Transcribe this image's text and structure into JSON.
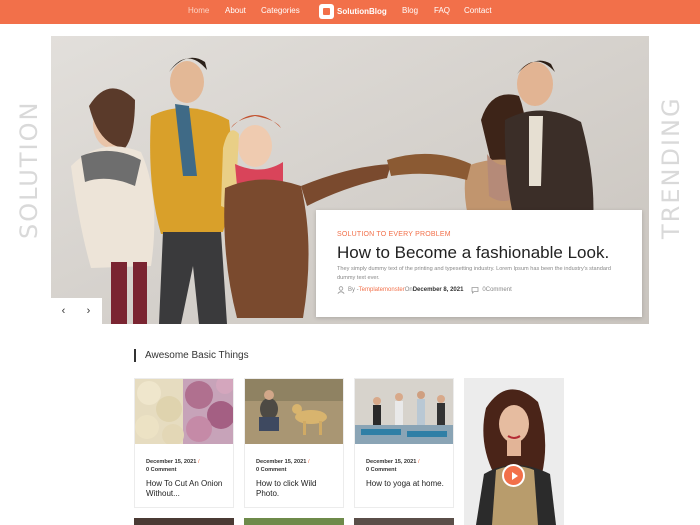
{
  "nav": {
    "items": [
      {
        "label": "Home",
        "active": true
      },
      {
        "label": "About"
      },
      {
        "label": "Categories"
      },
      {
        "label": "Blog"
      },
      {
        "label": "FAQ"
      },
      {
        "label": "Contact"
      }
    ],
    "logo_text": "SolutionBlog"
  },
  "hero": {
    "side_left": "SOLUTION",
    "side_right": "TRENDING",
    "kicker": "SOLUTION TO EVERY PROBLEM",
    "title": "How to Become a fashionable Look.",
    "description": "They simply dummy text of the printing and typesetting industry. Lorem Ipsum has been the industry's standard dummy text ever.",
    "meta": {
      "by": "By - ",
      "author": "Templatemonster",
      "on": " On ",
      "date": "December 8, 2021",
      "comments": "0Comment"
    },
    "prev_arrow": "‹",
    "next_arrow": "›"
  },
  "section": {
    "title": "Awesome Basic Things"
  },
  "posts": [
    {
      "date": "December 15, 2021",
      "sep": "/",
      "comment": "0 Comment",
      "title": "How To Cut An Onion Without..."
    },
    {
      "date": "December 15, 2021",
      "sep": "/",
      "comment": "0 Comment",
      "title": "How to click Wild Photo."
    },
    {
      "date": "December 15, 2021",
      "sep": "/",
      "comment": "0 Comment",
      "title": "How to yoga at home."
    }
  ],
  "colors": {
    "accent": "#f2704a",
    "text": "#222222",
    "muted": "#888888"
  },
  "icons": {
    "user": "user-icon",
    "comment": "comment-icon",
    "play": "play-icon"
  }
}
